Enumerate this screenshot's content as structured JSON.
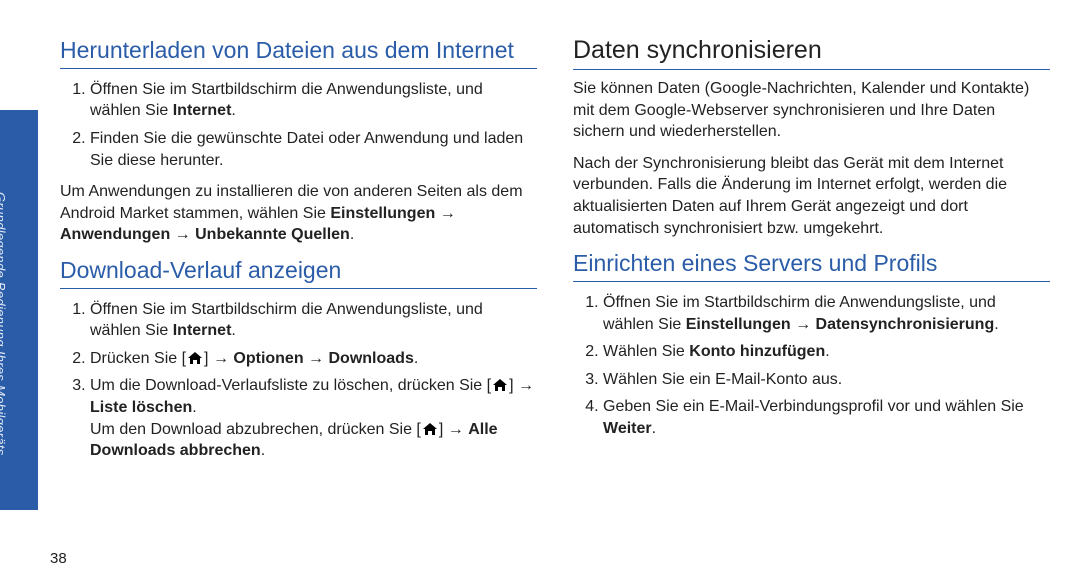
{
  "sidebar": {
    "label": "Grundlegende Bedienung Ihres Mobilgeräts"
  },
  "page_number": "38",
  "left": {
    "h1a": "Herunterladen von Dateien aus dem Internet",
    "list_a": [
      {
        "pre": "Öffnen Sie im Startbildschirm die Anwendungsliste, und wählen Sie ",
        "b1": "Internet",
        "post": "."
      },
      {
        "pre": "Finden Sie die gewünschte Datei oder Anwendung und laden Sie diese herunter.",
        "b1": "",
        "post": ""
      }
    ],
    "para_pre": "Um Anwendungen zu installieren die von anderen Seiten als dem Android Market stammen, wählen Sie ",
    "para_b1": "Einstellungen",
    "para_arrow": " → ",
    "para_b2": "Anwendungen",
    "para_b3": "Unbekannte Quellen",
    "para_end": ".",
    "h1b": "Download-Verlauf anzeigen",
    "list_b1_pre": "Öffnen Sie im Startbildschirm die Anwendungsliste, und wählen Sie ",
    "list_b1_b": "Internet",
    "list_b1_post": ".",
    "list_b2_pre": "Drücken Sie [",
    "list_b2_mid": "] → ",
    "list_b2_b1": "Optionen",
    "list_b2_b2": "Downloads",
    "list_b2_post": ".",
    "list_b3_pre": "Um die Download-Verlaufsliste zu löschen, drücken Sie [",
    "list_b3_mid": "] → ",
    "list_b3_b": "Liste löschen",
    "list_b3_post": ".",
    "list_b3_p2_pre": "Um den Download abzubrechen, drücken Sie [",
    "list_b3_p2_mid": "] → ",
    "list_b3_p2_b": "Alle Downloads abbrechen",
    "list_b3_p2_post": "."
  },
  "right": {
    "h2": "Daten synchronisieren",
    "p1": "Sie können Daten (Google-Nachrichten, Kalender und Kontakte) mit dem Google-Webserver synchronisieren und Ihre Daten sichern und wiederherstellen.",
    "p2": "Nach der Synchronisierung bleibt das Gerät mit dem Internet verbunden. Falls die Änderung im Internet erfolgt, werden die aktualisierten Daten auf Ihrem Gerät angezeigt und dort automatisch synchronisiert bzw. umgekehrt.",
    "h1": "Einrichten eines Servers und Profils",
    "li1_pre": "Öffnen Sie im Startbildschirm die Anwendungsliste, und wählen Sie ",
    "li1_b1": "Einstellungen",
    "li1_arrow": " → ",
    "li1_b2": "Datensynchronisierung",
    "li1_post": ".",
    "li2_pre": "Wählen Sie ",
    "li2_b": "Konto hinzufügen",
    "li2_post": ".",
    "li3": "Wählen Sie ein E-Mail-Konto aus.",
    "li4_pre": "Geben Sie ein E-Mail-Verbindungsprofil vor und wählen Sie ",
    "li4_b": "Weiter",
    "li4_post": "."
  }
}
